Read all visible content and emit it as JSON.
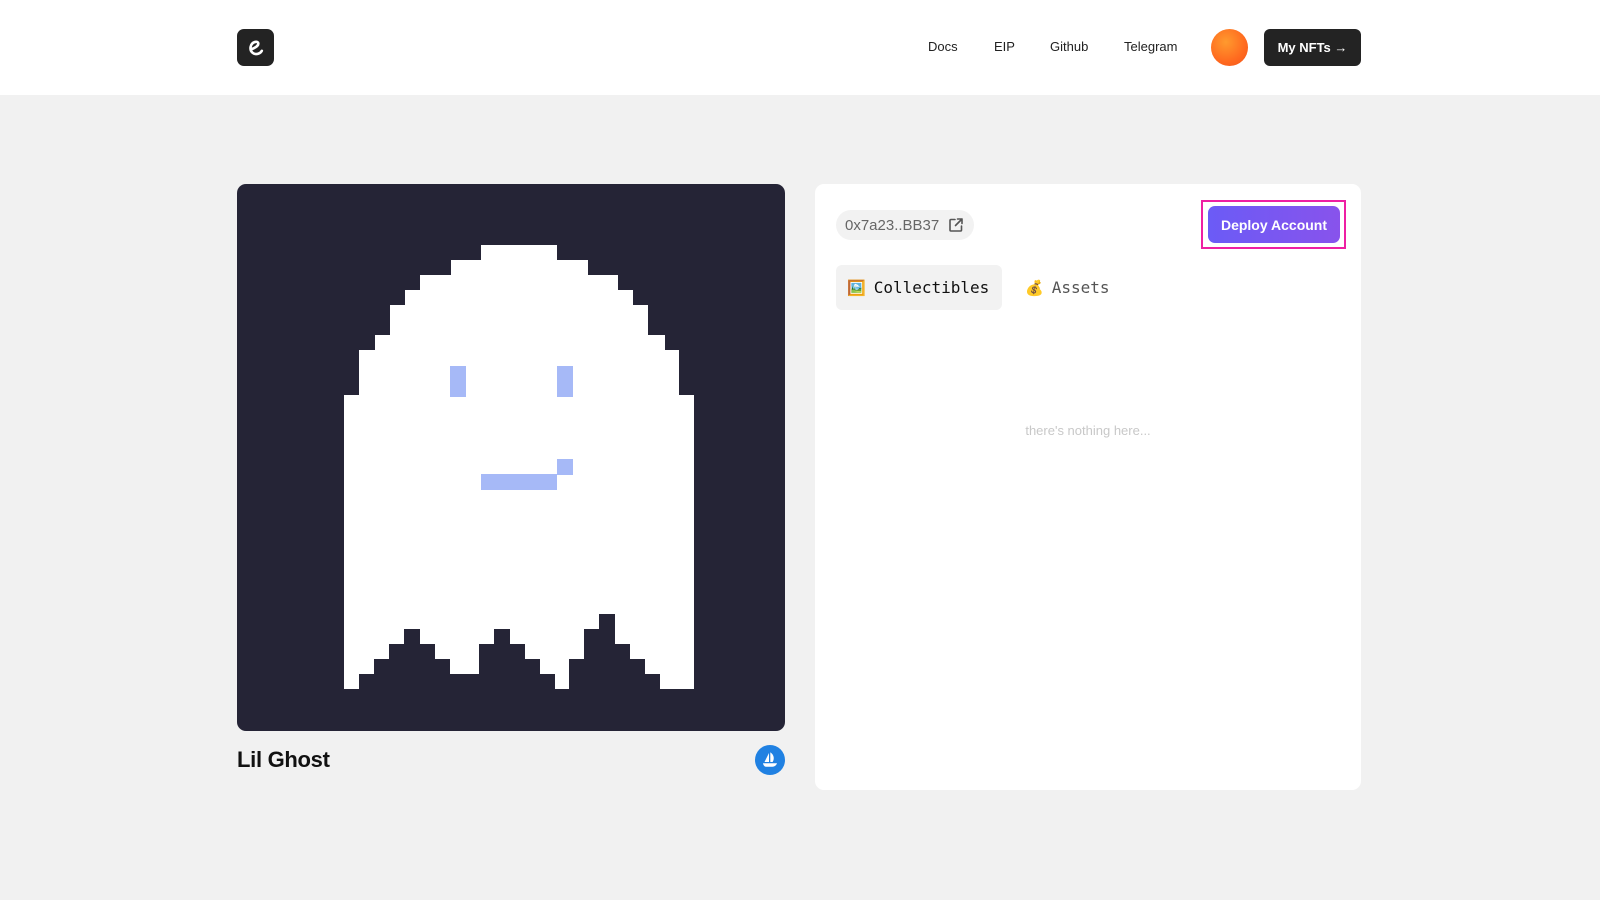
{
  "header": {
    "logo_icon": "e-swirl-logo-icon",
    "nav": [
      "Docs",
      "EIP",
      "Github",
      "Telegram"
    ],
    "avatar_icon": "user-avatar-gradient",
    "my_nfts_label": "My NFTs →"
  },
  "nft": {
    "name": "Lil Ghost",
    "image": "pixel-ghost",
    "marketplace_icon": "opensea-icon"
  },
  "account": {
    "address": "0x7a23..BB37",
    "address_icon": "external-link-icon",
    "deploy_label": "Deploy Account",
    "tabs": [
      {
        "icon": "🖼️",
        "label": "Collectibles",
        "active": true
      },
      {
        "icon": "💰",
        "label": "Assets",
        "active": false
      }
    ],
    "empty_text": "there's nothing here..."
  },
  "colors": {
    "nft_background": "#252436",
    "ghost_body": "#ffffff",
    "ghost_face": "#a6b9f7",
    "deploy_gradient_start": "#6b5bf6",
    "deploy_gradient_end": "#8853ec",
    "highlight_outline": "#ee1fa3",
    "opensea_blue": "#2081e2"
  }
}
